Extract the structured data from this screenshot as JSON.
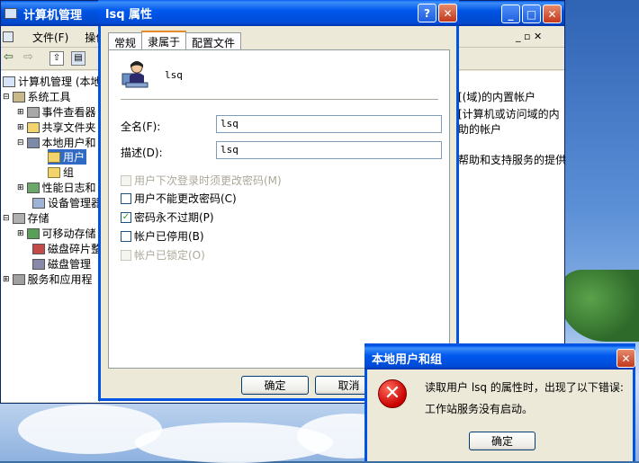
{
  "desktop": {
    "colors": {
      "sky": "#3a6ea5",
      "title_bar": "#0054e3"
    }
  },
  "computer_management": {
    "title": "计算机管理",
    "menu": [
      "文件(F)",
      "操作("
    ],
    "tree": [
      {
        "label": "计算机管理 (本地"
      },
      {
        "label": "系统工具"
      },
      {
        "label": "事件查看器"
      },
      {
        "label": "共享文件夹"
      },
      {
        "label": "本地用户和"
      },
      {
        "label": "用户"
      },
      {
        "label": "组"
      },
      {
        "label": "性能日志和"
      },
      {
        "label": "设备管理器"
      },
      {
        "label": "存储"
      },
      {
        "label": "可移动存储"
      },
      {
        "label": "磁盘碎片整"
      },
      {
        "label": "磁盘管理"
      },
      {
        "label": "服务和应用程"
      }
    ],
    "descriptions": [
      "[(域)的内置帐户",
      "[计算机或访问域的内",
      "助的帐户",
      "帮助和支持服务的提供"
    ]
  },
  "properties_dialog": {
    "title": "lsq 属性",
    "tabs": [
      "常规",
      "隶属于",
      "配置文件"
    ],
    "active_tab": "隶属于",
    "username": "lsq",
    "full_name_label": "全名(F):",
    "full_name_value": "lsq",
    "description_label": "描述(D):",
    "description_value": "lsq",
    "options": [
      {
        "label": "用户下次登录时须更改密码(M)",
        "checked": false,
        "disabled": true
      },
      {
        "label": "用户不能更改密码(C)",
        "checked": false,
        "disabled": false
      },
      {
        "label": "密码永不过期(P)",
        "checked": true,
        "disabled": false
      },
      {
        "label": "帐户已停用(B)",
        "checked": false,
        "disabled": false
      },
      {
        "label": "帐户已锁定(O)",
        "checked": false,
        "disabled": true
      }
    ],
    "ok_label": "确定",
    "cancel_label": "取消"
  },
  "error_dialog": {
    "title": "本地用户和组",
    "message_line1": "读取用户 lsq 的属性时，出现了以下错误:",
    "message_line2": "工作站服务没有启动。",
    "ok_label": "确定"
  }
}
